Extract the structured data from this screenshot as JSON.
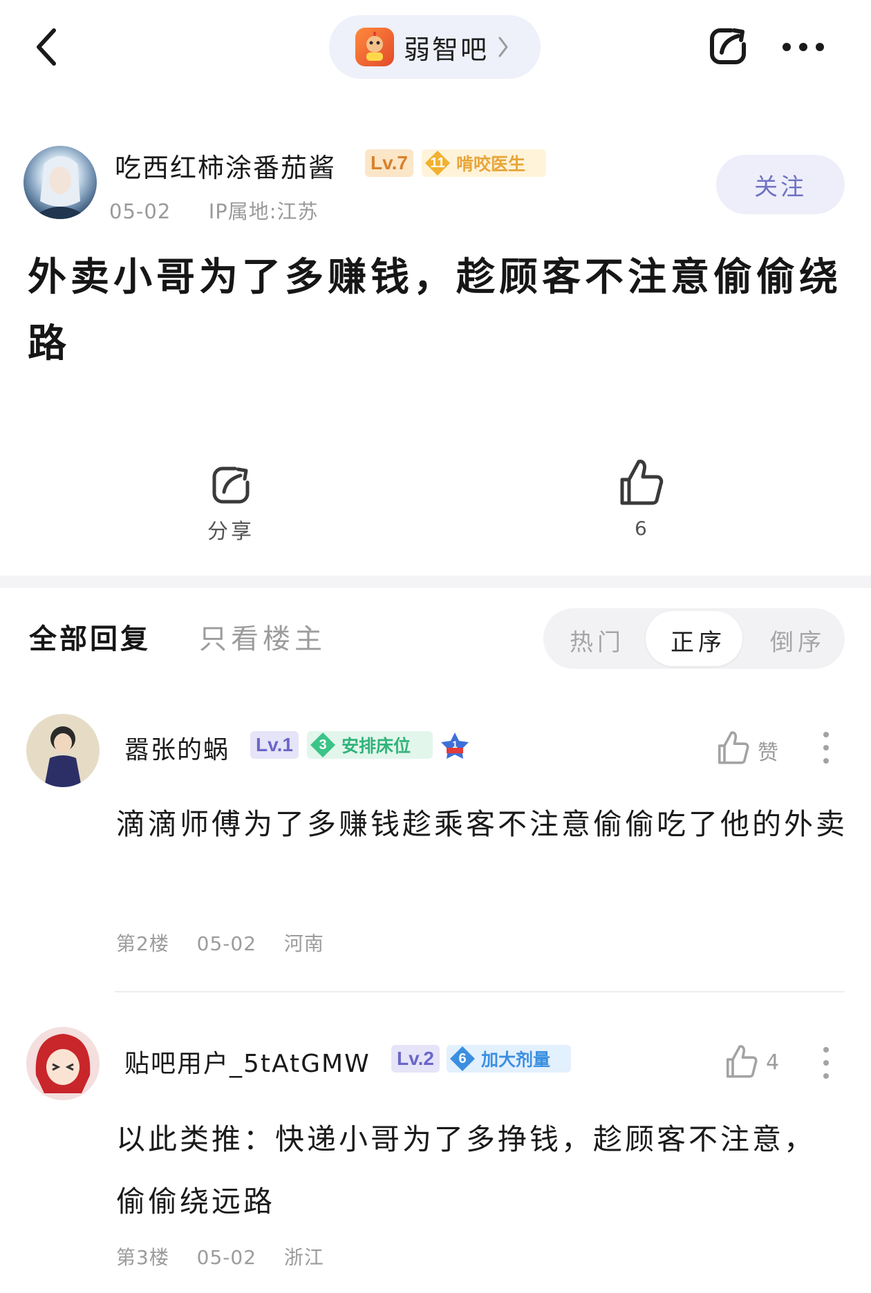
{
  "nav": {
    "forum_name": "弱智吧"
  },
  "post": {
    "author": {
      "name": "吃西红柿涂番茄酱",
      "level": "Lv.7",
      "badge_number": "11",
      "badge_title": "啃咬医生",
      "date": "05-02",
      "ip_location": "IP属地:江苏"
    },
    "follow_label": "关注",
    "title": "外卖小哥为了多赚钱，趁顾客不注意偷偷绕路",
    "share_label": "分享",
    "like_count": "6"
  },
  "tabs": {
    "all_replies": "全部回复",
    "op_only": "只看楼主",
    "sort_hot": "热门",
    "sort_asc": "正序",
    "sort_desc": "倒序",
    "selected_sort": "正序"
  },
  "replies": [
    {
      "user": "嚣张的蜗",
      "level": "Lv.1",
      "badge_number": "3",
      "badge_title": "安排床位",
      "rank_icon_number": "1",
      "like_label": "赞",
      "content": "滴滴师傅为了多赚钱趁乘客不注意偷偷吃了他的外卖",
      "floor": "第2楼",
      "date": "05-02",
      "location": "河南"
    },
    {
      "user": "贴吧用户_5tAtGMW",
      "level": "Lv.2",
      "badge_number": "6",
      "badge_title": "加大剂量",
      "like_label": "4",
      "content": "以此类推：快递小哥为了多挣钱，趁顾客不注意，偷偷绕远路",
      "floor": "第3楼",
      "date": "05-02",
      "location": "浙江"
    }
  ],
  "colors": {
    "accent": "#6f72c2",
    "op_level": "#d9812a",
    "op_badge": "#e8a53a",
    "reply1_badge": "#32b37a",
    "reply2_badge": "#3b8fe0",
    "muted_text": "#9c9c9c"
  }
}
